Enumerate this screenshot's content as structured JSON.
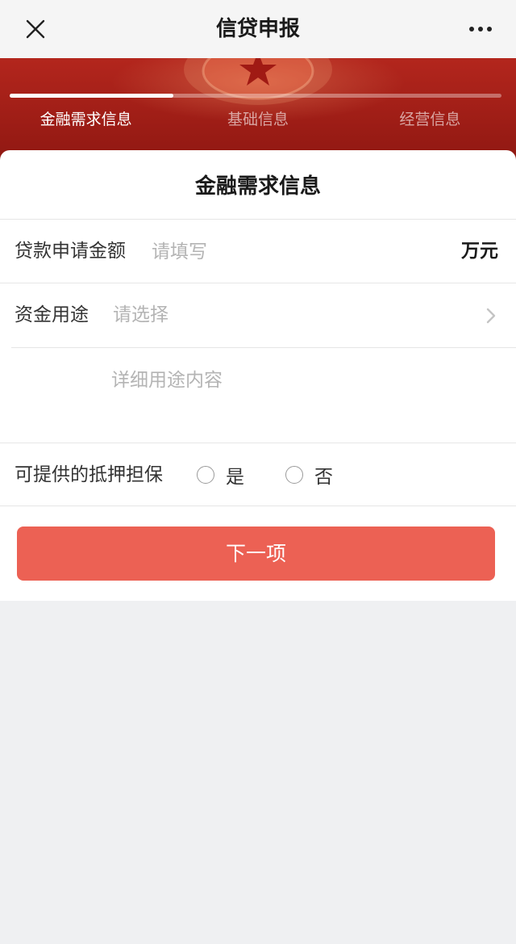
{
  "nav": {
    "title": "信贷申报",
    "close_icon": "close-icon",
    "more_icon": "more-dots-icon"
  },
  "steps": {
    "progress": 0.333,
    "tabs": [
      {
        "label": "金融需求信息",
        "active": true
      },
      {
        "label": "基础信息",
        "active": false
      },
      {
        "label": "经营信息",
        "active": false
      }
    ]
  },
  "form": {
    "title": "金融需求信息",
    "amount": {
      "label": "贷款申请金额",
      "placeholder": "请填写",
      "value": "",
      "unit": "万元"
    },
    "purpose": {
      "label": "资金用途",
      "placeholder": "请选择"
    },
    "detail": {
      "placeholder": "详细用途内容",
      "value": ""
    },
    "guarantee": {
      "label": "可提供的抵押担保",
      "options": [
        "是",
        "否"
      ]
    },
    "next_button": "下一项"
  },
  "colors": {
    "banner": "#a8221a",
    "accent_button": "#ec6154",
    "page_background": "#eff0f2"
  }
}
